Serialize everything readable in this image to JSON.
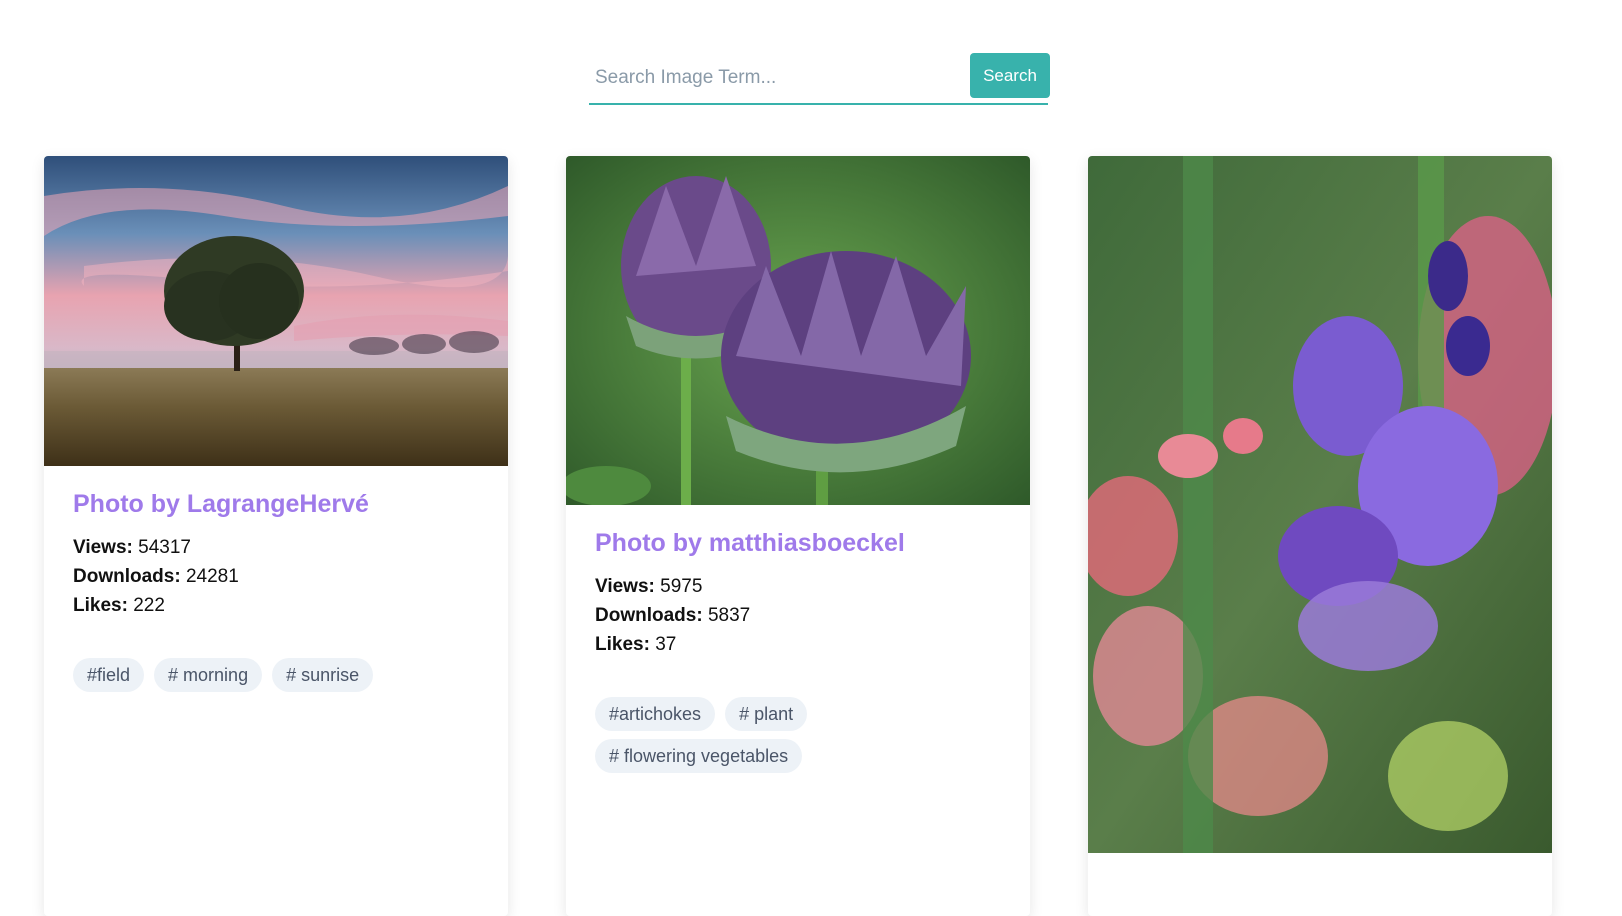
{
  "search": {
    "placeholder": "Search Image Term...",
    "value": "",
    "button_label": "Search"
  },
  "labels": {
    "views": "Views:",
    "downloads": "Downloads:",
    "likes": "Likes:"
  },
  "cards": [
    {
      "title": "Photo by LagrangeHervé",
      "views": "54317",
      "downloads": "24281",
      "likes": "222",
      "tags": [
        "#field",
        "# morning",
        "# sunrise"
      ],
      "image": "tree in a field at sunrise"
    },
    {
      "title": "Photo by matthiasboeckel",
      "views": "5975",
      "downloads": "5837",
      "likes": "37",
      "tags": [
        "#artichokes",
        "# plant",
        "# flowering vegetables"
      ],
      "image": "purple artichoke flowers"
    },
    {
      "image": "purple gladiolus flowers"
    }
  ],
  "colors": {
    "accent": "#38b2ac",
    "title": "#9f7aea",
    "tag_bg": "#edf2f7",
    "tag_text": "#4a5568"
  }
}
